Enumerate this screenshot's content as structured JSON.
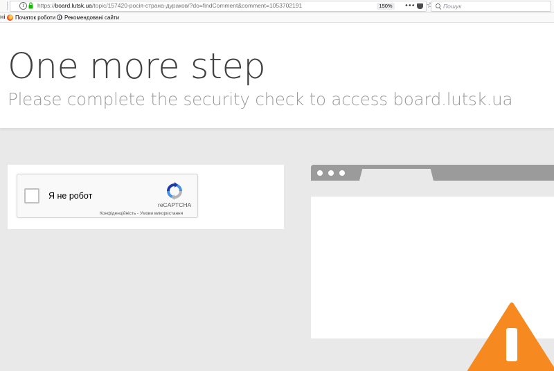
{
  "browser": {
    "url_prefix": "https://",
    "url_host": "board.lutsk.ua",
    "url_path": "/topic/157420-росія-страна-дураков/?do=findComment&comment=1053702191",
    "zoom": "150%",
    "search_placeholder": "Пошук",
    "page_actions_icon": "•••",
    "star_icon": "☆",
    "info_icon": "i"
  },
  "bookmarks": {
    "stub": "ні",
    "items": [
      {
        "label": "Початок роботи",
        "icon": "firefox-icon"
      },
      {
        "label": "Рекомендовані сайти",
        "icon": "globe-icon"
      }
    ]
  },
  "page": {
    "title": "One more step",
    "subtitle": "Please complete the security check to access board.lutsk.ua"
  },
  "captcha": {
    "label": "Я не робот",
    "brand": "reCAPTCHA",
    "privacy": "Конфіденційність",
    "separator": " - ",
    "terms": "Умови використання",
    "checked": false
  },
  "colors": {
    "warning": "#f6891f",
    "illustration_bar": "#9b9b9b",
    "background": "#e9e9e9"
  }
}
